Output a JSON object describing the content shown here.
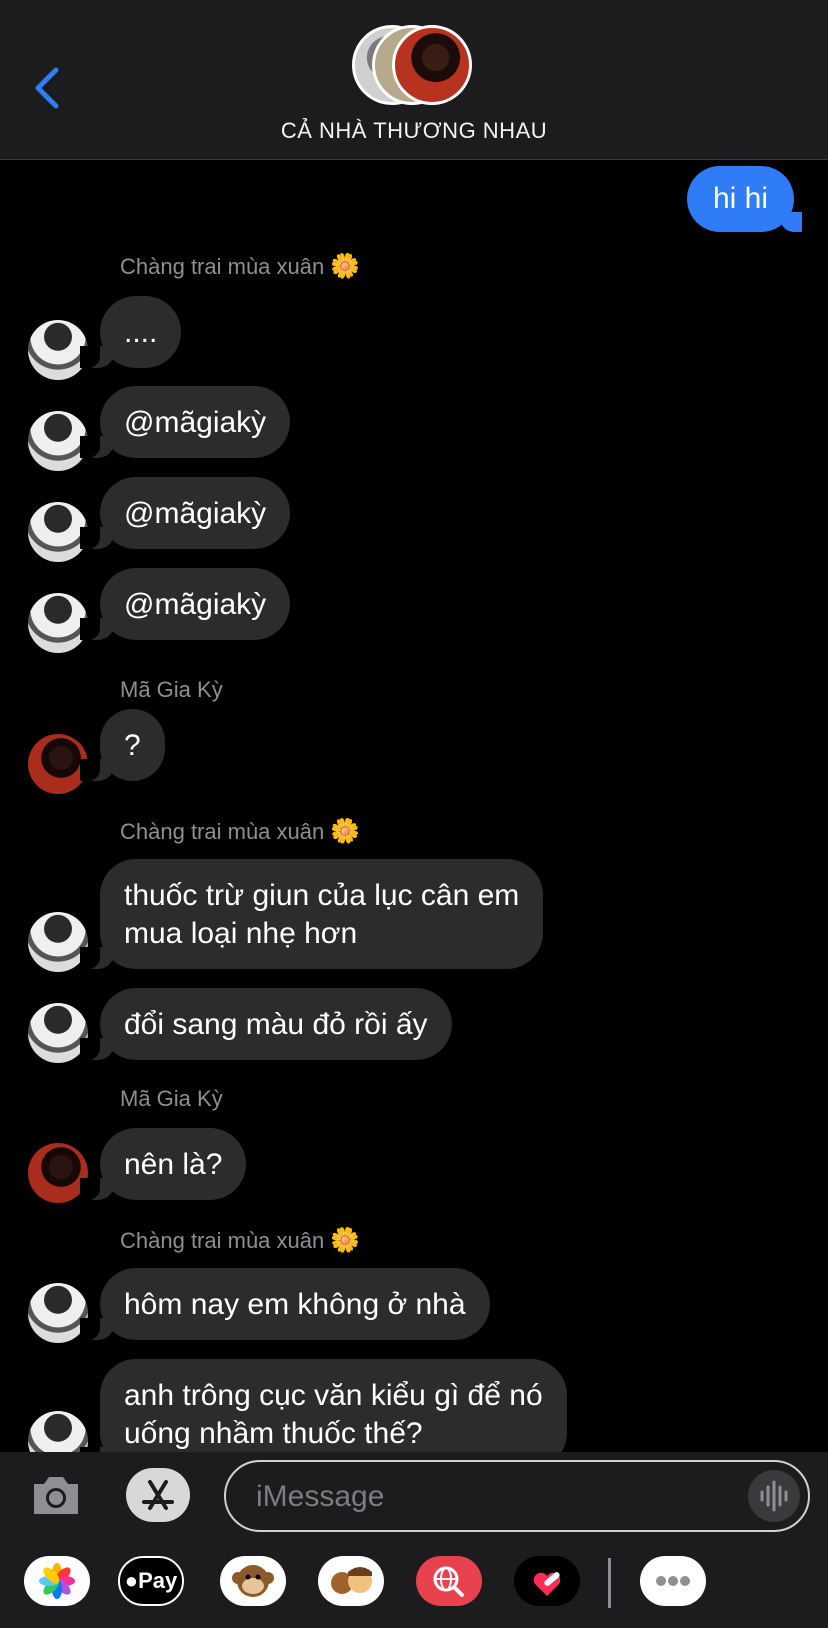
{
  "header": {
    "group_name": "CẢ NHÀ THƯƠNG NHAU",
    "back_icon": "chevron-left-icon"
  },
  "messages": {
    "outgoing": "hi hi",
    "senders": {
      "s1": "Chàng trai mùa xuân",
      "s2": "Mã Gia Kỳ",
      "s3": "Chàng trai mùa xuân",
      "s4": "Mã Gia Kỳ",
      "s5": "Chàng trai mùa xuân"
    },
    "flower": "🌼",
    "m1": "....",
    "m2": "@mãgiakỳ",
    "m3": "@mãgiakỳ",
    "m4": "@mãgiakỳ",
    "m5": "?",
    "m6_line1": "thuốc trừ giun của lục cân em",
    "m6_line2": "mua loại nhẹ hơn",
    "m7": "đổi sang màu đỏ rồi ấy",
    "m8": "nên là?",
    "m9": "hôm nay em không ở nhà",
    "m10_line1": "anh trông cục văn kiểu gì để nó",
    "m10_line2": "uống nhầm thuốc thế?"
  },
  "input": {
    "placeholder": "iMessage"
  },
  "drawer": {
    "apps": [
      "photos-app",
      "apple-pay-app",
      "animoji-app",
      "memoji-app",
      "image-search-app",
      "digital-touch-app",
      "more-apps"
    ],
    "pay_label": "Pay"
  },
  "colors": {
    "outgoing_bubble": "#2f7cf6",
    "incoming_bubble": "#2c2c2e",
    "accent": "#2f7cf6"
  }
}
